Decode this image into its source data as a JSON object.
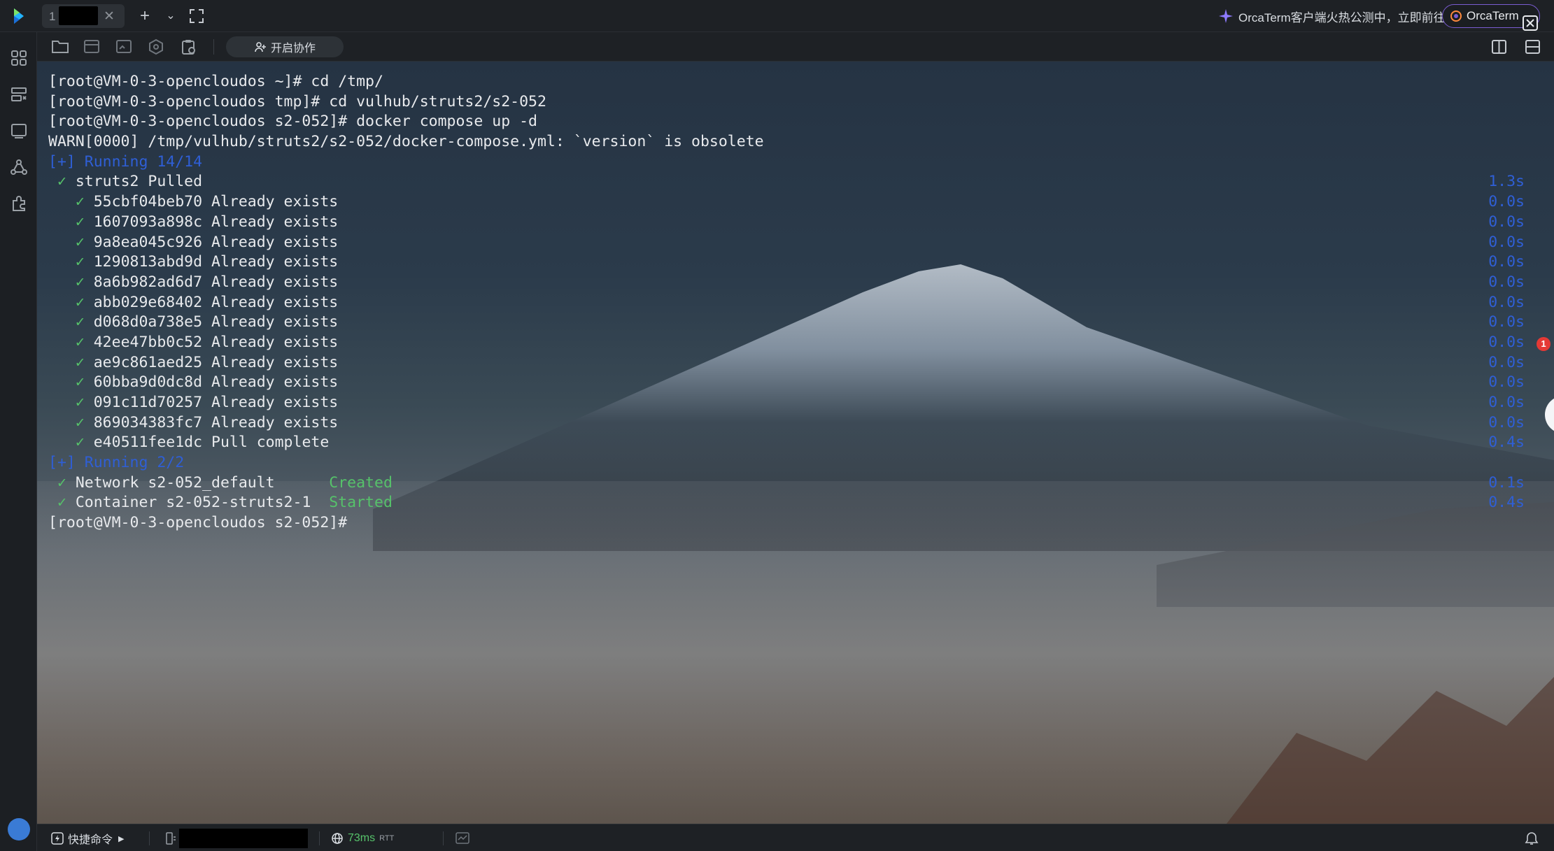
{
  "tabbar": {
    "tab_index": "1",
    "promo_text": "OrcaTerm客户端火热公测中，立即前往",
    "orca_button": "OrcaTerm"
  },
  "toolbar": {
    "collab_label": "开启协作"
  },
  "terminal": {
    "lines": [
      {
        "text": "[root@VM-0-3-opencloudos ~]# cd /tmp/"
      },
      {
        "text": "[root@VM-0-3-opencloudos tmp]# cd vulhub/struts2/s2-052"
      },
      {
        "text": "[root@VM-0-3-opencloudos s2-052]# docker compose up -d"
      },
      {
        "text": "WARN[0000] /tmp/vulhub/struts2/s2-052/docker-compose.yml: `version` is obsolete"
      },
      {
        "text": "[+] Running 14/14",
        "color": "blue"
      },
      {
        "check": true,
        "indent": " ",
        "text": "struts2 Pulled",
        "time": "1.3s"
      },
      {
        "check": true,
        "indent": "   ",
        "text": "55cbf04beb70 Already exists",
        "time": "0.0s"
      },
      {
        "check": true,
        "indent": "   ",
        "text": "1607093a898c Already exists",
        "time": "0.0s"
      },
      {
        "check": true,
        "indent": "   ",
        "text": "9a8ea045c926 Already exists",
        "time": "0.0s"
      },
      {
        "check": true,
        "indent": "   ",
        "text": "1290813abd9d Already exists",
        "time": "0.0s"
      },
      {
        "check": true,
        "indent": "   ",
        "text": "8a6b982ad6d7 Already exists",
        "time": "0.0s"
      },
      {
        "check": true,
        "indent": "   ",
        "text": "abb029e68402 Already exists",
        "time": "0.0s"
      },
      {
        "check": true,
        "indent": "   ",
        "text": "d068d0a738e5 Already exists",
        "time": "0.0s"
      },
      {
        "check": true,
        "indent": "   ",
        "text": "42ee47bb0c52 Already exists",
        "time": "0.0s"
      },
      {
        "check": true,
        "indent": "   ",
        "text": "ae9c861aed25 Already exists",
        "time": "0.0s"
      },
      {
        "check": true,
        "indent": "   ",
        "text": "60bba9d0dc8d Already exists",
        "time": "0.0s"
      },
      {
        "check": true,
        "indent": "   ",
        "text": "091c11d70257 Already exists",
        "time": "0.0s"
      },
      {
        "check": true,
        "indent": "   ",
        "text": "869034383fc7 Already exists",
        "time": "0.0s"
      },
      {
        "check": true,
        "indent": "   ",
        "text": "e40511fee1dc Pull complete",
        "time": "0.4s"
      },
      {
        "text": "[+] Running 2/2",
        "color": "blue"
      },
      {
        "check": true,
        "indent": " ",
        "text": "Network s2-052_default      ",
        "status": "Created",
        "time": "0.1s"
      },
      {
        "check": true,
        "indent": " ",
        "text": "Container s2-052-struts2-1  ",
        "status": "Started",
        "time": "0.4s"
      },
      {
        "text": "[root@VM-0-3-opencloudos s2-052]# "
      }
    ],
    "chat_badge": "1"
  },
  "statusbar": {
    "quick_commands": "快捷命令",
    "latency": "73ms",
    "rtt_label": "RTT"
  },
  "colors": {
    "accent_purple": "#7a5cd1",
    "terminal_blue": "#2f5fd6",
    "success_green": "#56c26a"
  },
  "icons": [
    "app-logo",
    "close-icon",
    "plus-icon",
    "chevron-down-icon",
    "fullscreen-icon",
    "sparkle-icon",
    "orca-logo-icon",
    "exit-fullscreen-icon",
    "grid-icon",
    "server-list-icon",
    "terminal-icon",
    "network-icon",
    "plugin-icon",
    "sftp-icon",
    "split-panel-icon",
    "globe-icon",
    "bell-icon"
  ]
}
